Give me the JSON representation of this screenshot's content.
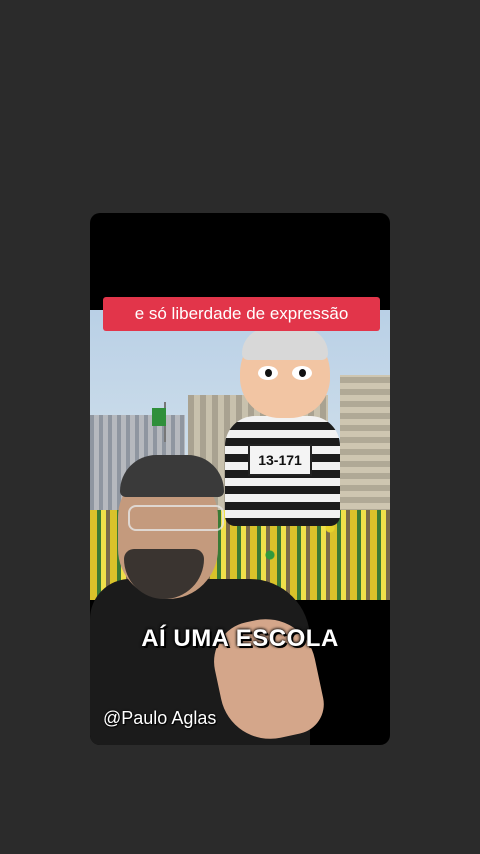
{
  "video": {
    "caption_top": "e só liberdade de expressão",
    "caption_bottom": "AÍ UMA ESCOLA",
    "watermark": "@Paulo Aglas",
    "inflatable_number": "13-171"
  },
  "colors": {
    "background": "#2b2b2b",
    "caption_bg": "#e2354a",
    "text": "#ffffff"
  }
}
